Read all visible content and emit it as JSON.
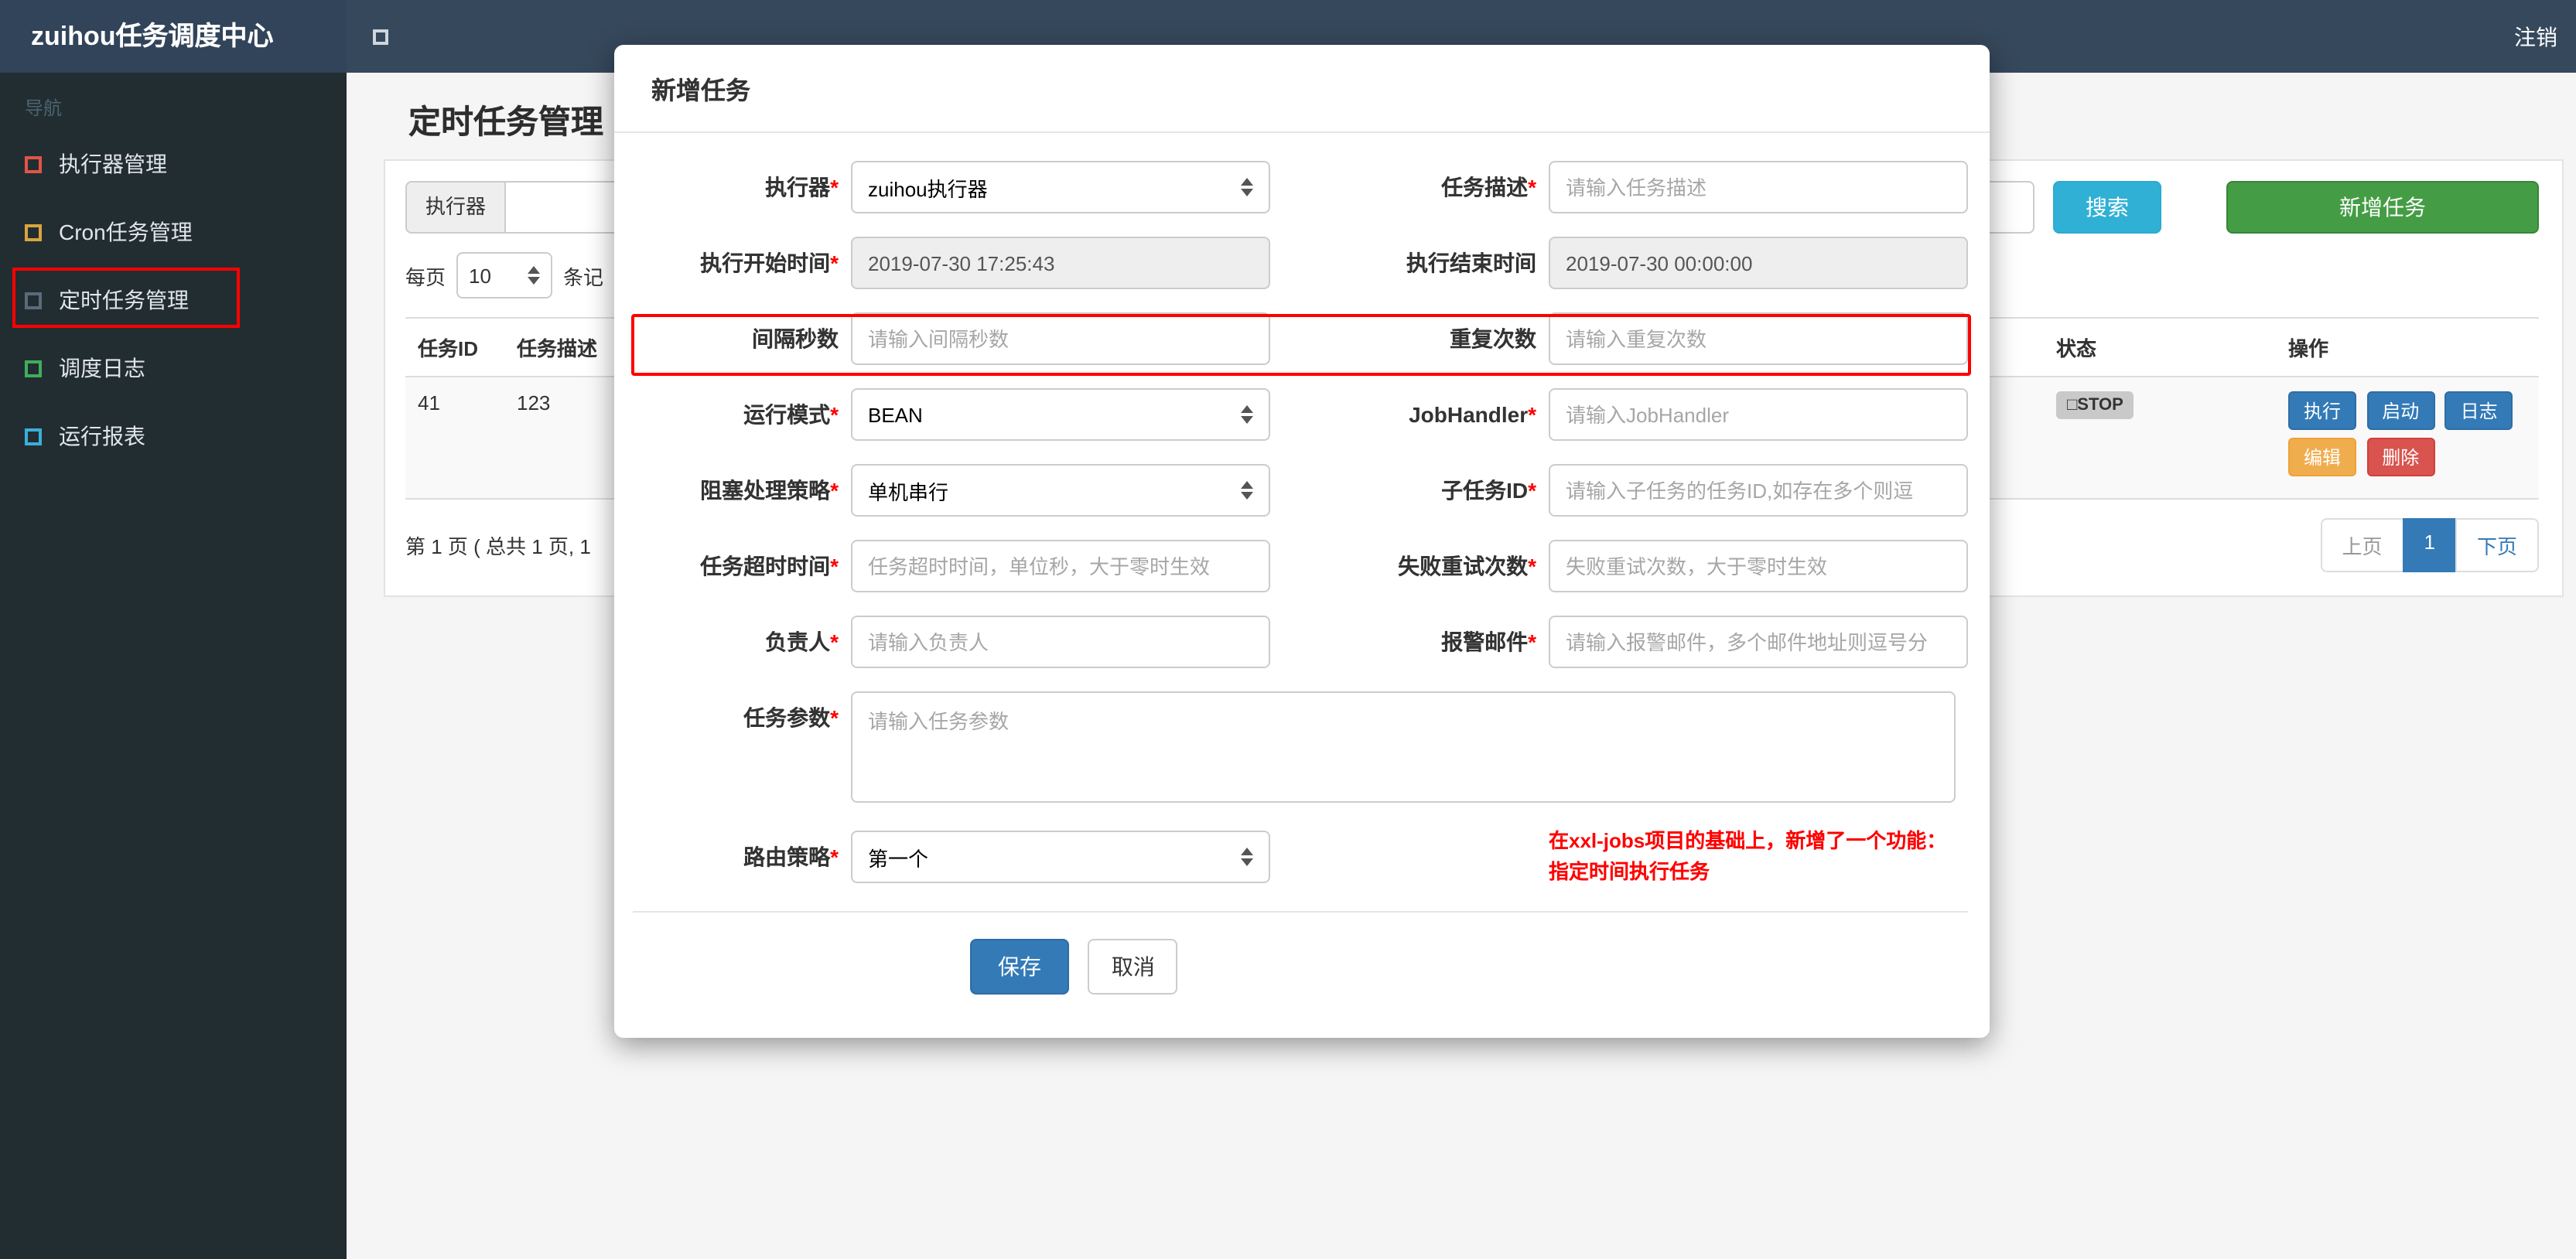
{
  "colors": {
    "topbar": "#36485c",
    "sidebar": "#222d32",
    "search_button": "#31b0d5",
    "add_button": "#449d44",
    "primary": "#337ab7",
    "warning": "#f0ad4e",
    "danger": "#d9534f",
    "annotation_highlight": "#ff0000"
  },
  "navbar": {
    "brand": "zuihou任务调度中心",
    "logout": "注销"
  },
  "sidebar": {
    "section_label": "导航",
    "items": [
      {
        "label": "执行器管理",
        "icon_color": "#e05548"
      },
      {
        "label": "Cron任务管理",
        "icon_color": "#d9a43c"
      },
      {
        "label": "定时任务管理",
        "icon_color": "#5a6b7a"
      },
      {
        "label": "调度日志",
        "icon_color": "#3fae5a"
      },
      {
        "label": "运行报表",
        "icon_color": "#3bafda"
      }
    ]
  },
  "page": {
    "title": "定时任务管理",
    "filter": {
      "executor_label": "执行器",
      "search": "搜索",
      "add": "新增任务"
    },
    "per_page": {
      "prefix": "每页",
      "value": "10",
      "suffix": "条记"
    },
    "table": {
      "columns": [
        "任务ID",
        "任务描述",
        "状态",
        "操作"
      ],
      "row": {
        "id": "41",
        "desc": "123",
        "status": "□STOP",
        "actions": [
          "执行",
          "启动",
          "日志",
          "编辑",
          "删除"
        ]
      }
    },
    "pagination": {
      "info": "第 1 页 ( 总共 1 页, 1",
      "prev": "上页",
      "current": "1",
      "next": "下页"
    }
  },
  "modal": {
    "title": "新增任务",
    "executor": {
      "label": "执行器",
      "star": "*",
      "value": "zuihou执行器"
    },
    "job_desc": {
      "label": "任务描述",
      "star": "*",
      "placeholder": "请输入任务描述"
    },
    "start_time": {
      "label": "执行开始时间",
      "star": "*",
      "value": "2019-07-30 17:25:43"
    },
    "end_time": {
      "label": "执行结束时间",
      "star": "",
      "value": "2019-07-30 00:00:00"
    },
    "interval": {
      "label": "间隔秒数",
      "star": "",
      "placeholder": "请输入间隔秒数"
    },
    "repeat_count": {
      "label": "重复次数",
      "star": "",
      "placeholder": "请输入重复次数"
    },
    "glue_type": {
      "label": "运行模式",
      "star": "*",
      "value": "BEAN"
    },
    "job_handler": {
      "label": "JobHandler",
      "star": "*",
      "placeholder": "请输入JobHandler"
    },
    "block_strategy": {
      "label": "阻塞处理策略",
      "star": "*",
      "value": "单机串行"
    },
    "child_job": {
      "label": "子任务ID",
      "star": "*",
      "placeholder": "请输入子任务的任务ID,如存在多个则逗"
    },
    "timeout": {
      "label": "任务超时时间",
      "star": "*",
      "placeholder": "任务超时时间，单位秒，大于零时生效"
    },
    "retry": {
      "label": "失败重试次数",
      "star": "*",
      "placeholder": "失败重试次数，大于零时生效"
    },
    "author": {
      "label": "负责人",
      "star": "*",
      "placeholder": "请输入负责人"
    },
    "alarm_email": {
      "label": "报警邮件",
      "star": "*",
      "placeholder": "请输入报警邮件，多个邮件地址则逗号分"
    },
    "job_param": {
      "label": "任务参数",
      "star": "*",
      "placeholder": "请输入任务参数"
    },
    "route_strategy": {
      "label": "路由策略",
      "star": "*",
      "value": "第一个"
    },
    "note_line1": "在xxl-jobs项目的基础上，新增了一个功能：",
    "note_line2": "指定时间执行任务",
    "save_label": "保存",
    "cancel_label": "取消"
  }
}
